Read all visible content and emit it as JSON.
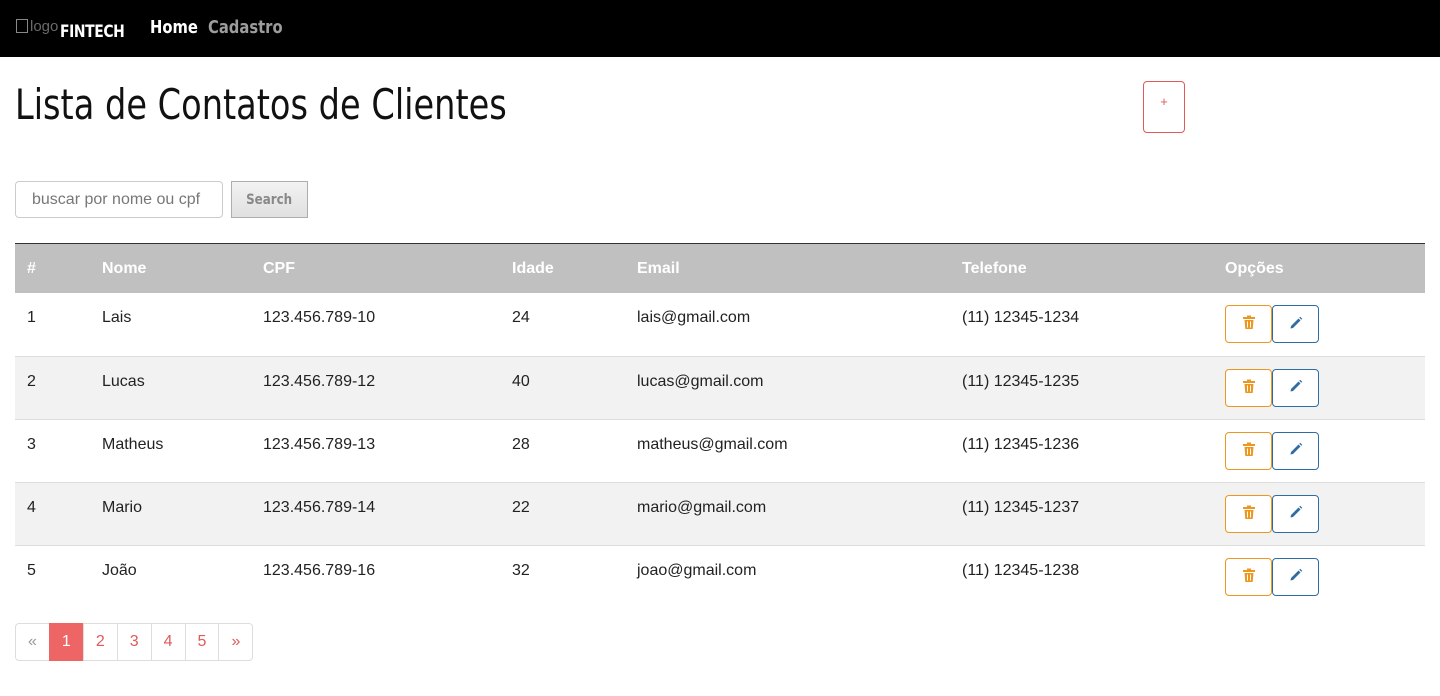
{
  "navbar": {
    "logo_alt": "logo",
    "brand": "FINTECH",
    "links": [
      {
        "label": "Home",
        "active": true
      },
      {
        "label": "Cadastro",
        "active": false
      }
    ]
  },
  "header": {
    "title": "Lista de Contatos de Clientes",
    "add_button_label": "+"
  },
  "search": {
    "placeholder": "buscar por nome ou cpf",
    "value": "",
    "button_label": "Search"
  },
  "table": {
    "columns": [
      "#",
      "Nome",
      "CPF",
      "Idade",
      "Email",
      "Telefone",
      "Opções"
    ],
    "rows": [
      {
        "idx": "1",
        "nome": "Lais",
        "cpf": "123.456.789-10",
        "idade": "24",
        "email": "lais@gmail.com",
        "telefone": "(11) 12345-1234"
      },
      {
        "idx": "2",
        "nome": "Lucas",
        "cpf": "123.456.789-12",
        "idade": "40",
        "email": "lucas@gmail.com",
        "telefone": "(11) 12345-1235"
      },
      {
        "idx": "3",
        "nome": "Matheus",
        "cpf": "123.456.789-13",
        "idade": "28",
        "email": "matheus@gmail.com",
        "telefone": "(11) 12345-1236"
      },
      {
        "idx": "4",
        "nome": "Mario",
        "cpf": "123.456.789-14",
        "idade": "22",
        "email": "mario@gmail.com",
        "telefone": "(11) 12345-1237"
      },
      {
        "idx": "5",
        "nome": "João",
        "cpf": "123.456.789-16",
        "idade": "32",
        "email": "joao@gmail.com",
        "telefone": "(11) 12345-1238"
      }
    ],
    "row_actions": [
      "trash-icon",
      "pencil-icon"
    ]
  },
  "pagination": {
    "prev": "«",
    "pages": [
      "1",
      "2",
      "3",
      "4",
      "5"
    ],
    "active_page": "1",
    "next": "»"
  },
  "colors": {
    "navbar_bg": "#000000",
    "header_row_bg": "#c0c0c0",
    "accent": "#ee6565",
    "delete_orange": "#ec971f",
    "edit_blue": "#2e6da4"
  }
}
